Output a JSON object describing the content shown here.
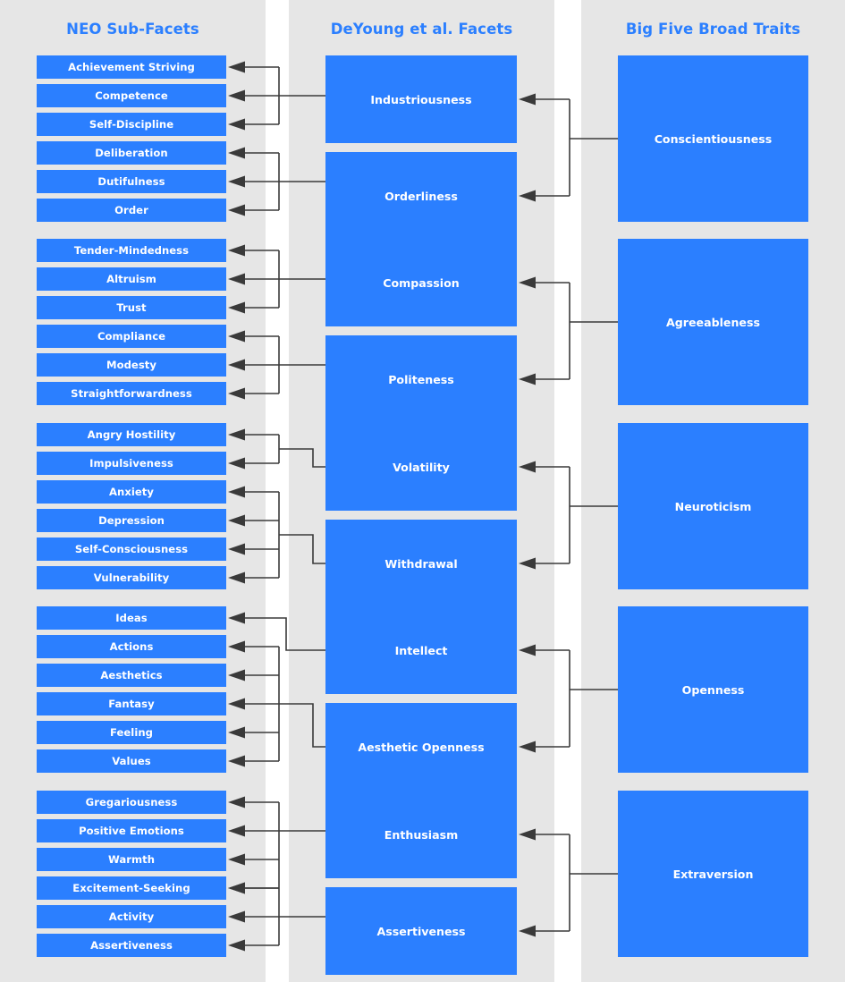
{
  "columns": {
    "left_header": "NEO Sub-Facets",
    "middle_header": "DeYoung et al. Facets",
    "right_header": "Big Five Broad Traits"
  },
  "colors": {
    "node_fill": "#2b7fff",
    "node_text": "#ffffff",
    "header_text": "#2b7fff",
    "band_background": "#e6e6e6",
    "page_background": "#ffffff",
    "connector": "#3a3a3a"
  },
  "groups": [
    {
      "trait": "Conscientiousness",
      "facets": [
        {
          "name": "Industriousness",
          "subfacets": [
            "Achievement Striving",
            "Competence",
            "Self-Discipline"
          ]
        },
        {
          "name": "Orderliness",
          "subfacets": [
            "Deliberation",
            "Dutifulness",
            "Order"
          ]
        }
      ]
    },
    {
      "trait": "Agreeableness",
      "facets": [
        {
          "name": "Compassion",
          "subfacets": [
            "Tender-Mindedness",
            "Altruism",
            "Trust"
          ]
        },
        {
          "name": "Politeness",
          "subfacets": [
            "Compliance",
            "Modesty",
            "Straightforwardness"
          ]
        }
      ]
    },
    {
      "trait": "Neuroticism",
      "facets": [
        {
          "name": "Volatility",
          "subfacets": [
            "Angry Hostility",
            "Impulsiveness"
          ]
        },
        {
          "name": "Withdrawal",
          "subfacets": [
            "Anxiety",
            "Depression",
            "Self-Consciousness",
            "Vulnerability"
          ]
        }
      ]
    },
    {
      "trait": "Openness",
      "facets": [
        {
          "name": "Intellect",
          "subfacets": [
            "Ideas"
          ]
        },
        {
          "name": "Aesthetic Openness",
          "subfacets": [
            "Actions",
            "Aesthetics",
            "Fantasy",
            "Feeling",
            "Values"
          ]
        }
      ]
    },
    {
      "trait": "Extraversion",
      "facets": [
        {
          "name": "Enthusiasm",
          "subfacets": [
            "Gregariousness",
            "Positive Emotions",
            "Warmth",
            "Excitement-Seeking"
          ]
        },
        {
          "name": "Assertiveness",
          "subfacets": [
            "Excitement-Seeking",
            "Activity",
            "Assertiveness"
          ]
        }
      ]
    }
  ],
  "subfacet_column_order": [
    "Achievement Striving",
    "Competence",
    "Self-Discipline",
    "Deliberation",
    "Dutifulness",
    "Order",
    "Tender-Mindedness",
    "Altruism",
    "Trust",
    "Compliance",
    "Modesty",
    "Straightforwardness",
    "Angry Hostility",
    "Impulsiveness",
    "Anxiety",
    "Depression",
    "Self-Consciousness",
    "Vulnerability",
    "Ideas",
    "Actions",
    "Aesthetics",
    "Fantasy",
    "Feeling",
    "Values",
    "Gregariousness",
    "Positive Emotions",
    "Warmth",
    "Excitement-Seeking",
    "Activity",
    "Assertiveness"
  ],
  "facet_column_order": [
    "Industriousness",
    "Orderliness",
    "Compassion",
    "Politeness",
    "Volatility",
    "Withdrawal",
    "Intellect",
    "Aesthetic Openness",
    "Enthusiasm",
    "Assertiveness"
  ],
  "trait_column_order": [
    "Conscientiousness",
    "Agreeableness",
    "Neuroticism",
    "Openness",
    "Extraversion"
  ]
}
